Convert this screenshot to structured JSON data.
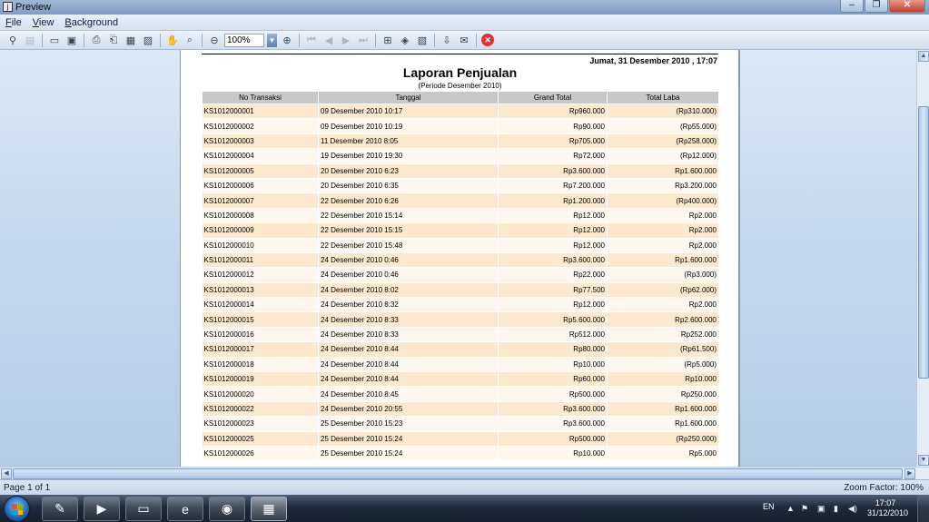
{
  "window": {
    "title": "Preview"
  },
  "menu": [
    "File",
    "View",
    "Background"
  ],
  "toolbar": {
    "zoom": "100%"
  },
  "report": {
    "date_line": "Jumat, 31 Desember 2010 , 17:07",
    "title": "Laporan Penjualan",
    "subtitle": "(Periode Desember 2010)",
    "columns": [
      "No Transaksi",
      "Tanggal",
      "Grand Total",
      "Total Laba"
    ],
    "rows": [
      [
        "KS1012000001",
        "09 Desember 2010 10:17",
        "Rp960.000",
        "(Rp310.000)"
      ],
      [
        "KS1012000002",
        "09 Desember 2010 10:19",
        "Rp90.000",
        "(Rp55.000)"
      ],
      [
        "KS1012000003",
        "11 Desember 2010 8:05",
        "Rp705.000",
        "(Rp258.000)"
      ],
      [
        "KS1012000004",
        "19 Desember 2010 19:30",
        "Rp72.000",
        "(Rp12.000)"
      ],
      [
        "KS1012000005",
        "20 Desember 2010 6:23",
        "Rp3.600.000",
        "Rp1.600.000"
      ],
      [
        "KS1012000006",
        "20 Desember 2010 6:35",
        "Rp7.200.000",
        "Rp3.200.000"
      ],
      [
        "KS1012000007",
        "22 Desember 2010 6:26",
        "Rp1.200.000",
        "(Rp400.000)"
      ],
      [
        "KS1012000008",
        "22 Desember 2010 15:14",
        "Rp12.000",
        "Rp2.000"
      ],
      [
        "KS1012000009",
        "22 Desember 2010 15:15",
        "Rp12.000",
        "Rp2.000"
      ],
      [
        "KS1012000010",
        "22 Desember 2010 15:48",
        "Rp12.000",
        "Rp2.000"
      ],
      [
        "KS1012000011",
        "24 Desember 2010 0:46",
        "Rp3.600.000",
        "Rp1.600.000"
      ],
      [
        "KS1012000012",
        "24 Desember 2010 0:46",
        "Rp22.000",
        "(Rp3.000)"
      ],
      [
        "KS1012000013",
        "24 Desember 2010 8:02",
        "Rp77.500",
        "(Rp62.000)"
      ],
      [
        "KS1012000014",
        "24 Desember 2010 8:32",
        "Rp12.000",
        "Rp2.000"
      ],
      [
        "KS1012000015",
        "24 Desember 2010 8:33",
        "Rp5.600.000",
        "Rp2.600.000"
      ],
      [
        "KS1012000016",
        "24 Desember 2010 8:33",
        "Rp512.000",
        "Rp252.000"
      ],
      [
        "KS1012000017",
        "24 Desember 2010 8:44",
        "Rp80.000",
        "(Rp61.500)"
      ],
      [
        "KS1012000018",
        "24 Desember 2010 8:44",
        "Rp10.000",
        "(Rp5.000)"
      ],
      [
        "KS1012000019",
        "24 Desember 2010 8:44",
        "Rp60.000",
        "Rp10.000"
      ],
      [
        "KS1012000020",
        "24 Desember 2010 8:45",
        "Rp500.000",
        "Rp250.000"
      ],
      [
        "KS1012000022",
        "24 Desember 2010 20:55",
        "Rp3.600.000",
        "Rp1.600.000"
      ],
      [
        "KS1012000023",
        "25 Desember 2010 15:23",
        "Rp3.600.000",
        "Rp1.600.000"
      ],
      [
        "KS1012000025",
        "25 Desember 2010 15:24",
        "Rp500.000",
        "(Rp250.000)"
      ],
      [
        "KS1012000026",
        "25 Desember 2010 15:24",
        "Rp10.000",
        "Rp5.000"
      ]
    ]
  },
  "status": {
    "page": "Page 1 of 1",
    "zoom_factor": "Zoom Factor: 100%"
  },
  "taskbar": {
    "language": "EN",
    "time": "17:07",
    "date": "31/12/2010",
    "apps": [
      "paint-icon",
      "media-player-icon",
      "explorer-folder-icon",
      "internet-explorer-icon",
      "app-icon",
      "office-icon"
    ]
  }
}
